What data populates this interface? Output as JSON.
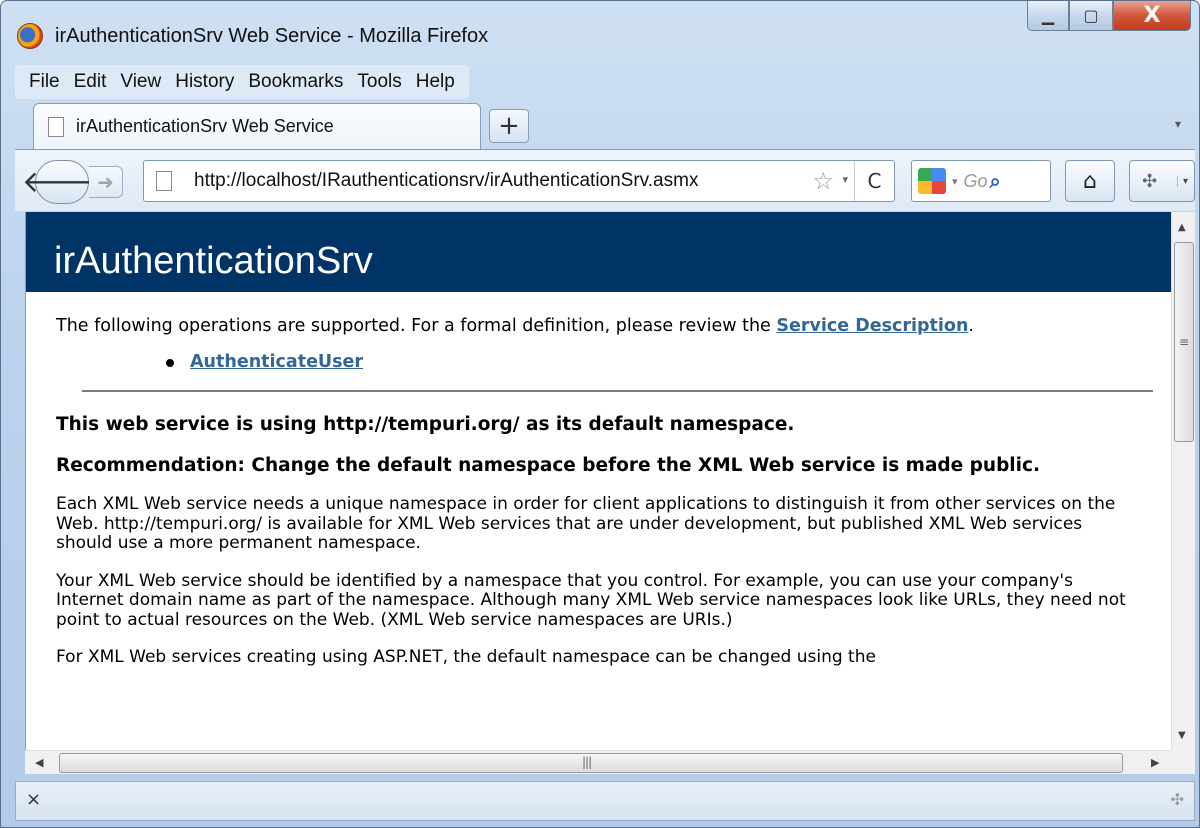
{
  "window": {
    "title": "irAuthenticationSrv Web Service - Mozilla Firefox",
    "controls": {
      "minimize": "▁",
      "maximize": "▢",
      "close": "X"
    }
  },
  "menubar": {
    "items": [
      "File",
      "Edit",
      "View",
      "History",
      "Bookmarks",
      "Tools",
      "Help"
    ]
  },
  "tab": {
    "label": "irAuthenticationSrv Web Service",
    "new_tab": "+"
  },
  "navbar": {
    "url": "http://localhost/IRauthenticationsrv/irAuthenticationSrv.asmx",
    "search_placeholder": "Go",
    "icons": [
      "back-arrow-icon",
      "forward-arrow-icon",
      "page-icon",
      "star-icon",
      "reload-icon",
      "google-icon",
      "search-icon",
      "home-icon",
      "addon-icon"
    ]
  },
  "page": {
    "header": "irAuthenticationSrv",
    "intro_text": "The following operations are supported. For a formal definition, please review the ",
    "service_description_link": "Service Description",
    "intro_end": ".",
    "operations": [
      "AuthenticateUser"
    ],
    "namespace_heading": "This web service is using http://tempuri.org/ as its default namespace.",
    "recommendation_heading": "Recommendation: Change the default namespace before the XML Web service is made public.",
    "para1": "Each XML Web service needs a unique namespace in order for client applications to distinguish it from other services on the Web. http://tempuri.org/ is available for XML Web services that are under development, but published XML Web services should use a more permanent namespace.",
    "para2": "Your XML Web service should be identified by a namespace that you control. For example, you can use your company's Internet domain name as part of the namespace. Although many XML Web service namespaces look like URLs, they need not point to actual resources on the Web. (XML Web service namespaces are URIs.)",
    "para3": "For XML Web services creating using ASP.NET, the default namespace can be changed using the"
  },
  "statusbar": {
    "close": "×"
  },
  "colors": {
    "header_bg": "#003366",
    "link": "#336699"
  }
}
